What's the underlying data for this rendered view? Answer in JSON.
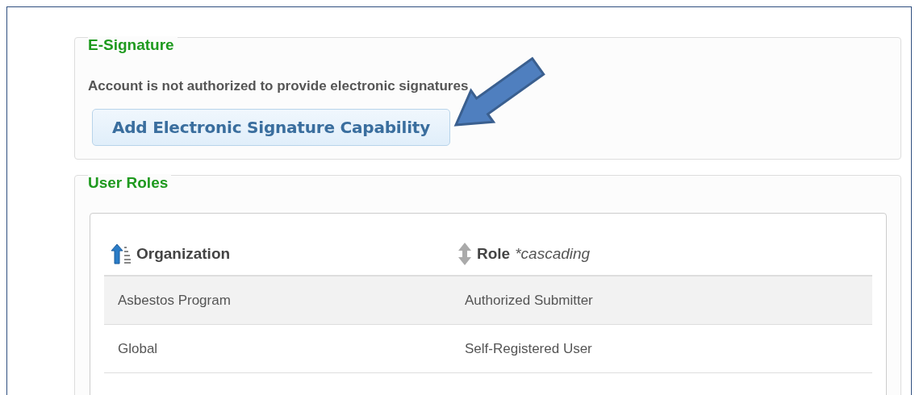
{
  "esignature": {
    "title": "E-Signature",
    "message": "Account is not authorized to provide electronic signatures",
    "button": "Add Electronic Signature Capability"
  },
  "user_roles": {
    "title": "User Roles",
    "columns": [
      {
        "label": "Organization",
        "sorted": true
      },
      {
        "label": "Role",
        "note": "*cascading",
        "sorted": false
      }
    ],
    "rows": [
      {
        "cells": [
          "Asbestos Program",
          "Authorized Submitter"
        ]
      },
      {
        "cells": [
          "Global",
          "Self-Registered User"
        ]
      }
    ]
  }
}
